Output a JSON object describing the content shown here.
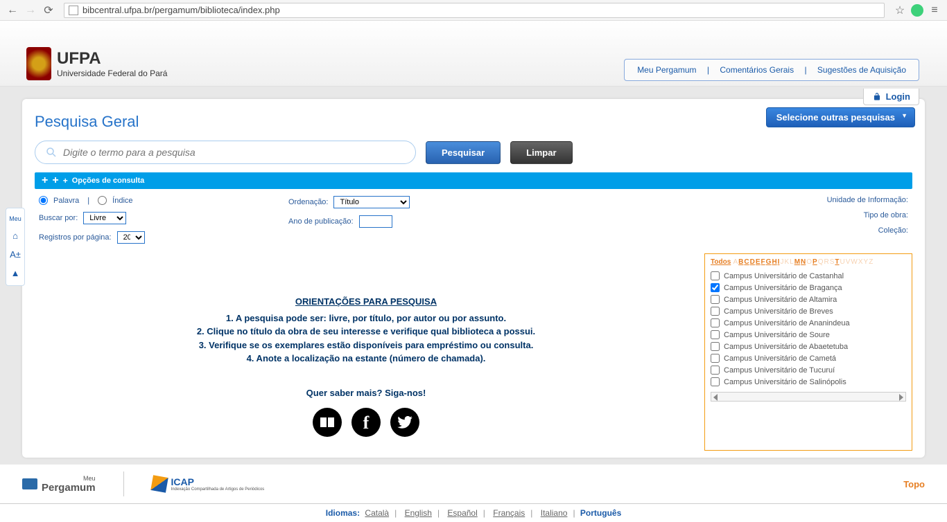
{
  "browser": {
    "url": "bibcentral.ufpa.br/pergamum/biblioteca/index.php"
  },
  "header": {
    "org_short": "UFPA",
    "org_full": "Universidade Federal do Pará",
    "links": {
      "my_pergamum": "Meu Pergamum",
      "comments": "Comentários Gerais",
      "suggestions": "Sugestões de Aquisição"
    },
    "login": "Login"
  },
  "search": {
    "title": "Pesquisa Geral",
    "other_searches": "Selecione outras pesquisas",
    "placeholder": "Digite o termo para a pesquisa",
    "btn_search": "Pesquisar",
    "btn_clear": "Limpar"
  },
  "options": {
    "title": "Opções de consulta",
    "mode_word": "Palavra",
    "mode_index": "Índice",
    "search_by_label": "Buscar por:",
    "search_by_value": "Livre",
    "records_label": "Registros por página:",
    "records_value": "20",
    "sort_label": "Ordenação:",
    "sort_value": "Título",
    "year_label": "Ano de publicação:",
    "unit_label": "Unidade de Informação:",
    "type_label": "Tipo de obra:",
    "collection_label": "Coleção:"
  },
  "instructions": {
    "title": "ORIENTAÇÕES PARA PESQUISA",
    "line1": "1. A pesquisa pode ser: livre, por título, por autor ou por assunto.",
    "line2": "2. Clique no título da obra de seu interesse e verifique qual biblioteca a possui.",
    "line3": "3. Verifique se os exemplares estão disponíveis para empréstimo ou consulta.",
    "line4": "4. Anote a localização na estante (número de chamada).",
    "follow": "Quer saber mais? Siga-nos!"
  },
  "alpha": {
    "todos": "Todos",
    "letters": [
      "A",
      "B",
      "C",
      "D",
      "E",
      "F",
      "G",
      "H",
      "I",
      "J",
      "K",
      "L",
      "M",
      "N",
      "O",
      "P",
      "Q",
      "R",
      "S",
      "T",
      "U",
      "V",
      "W",
      "X",
      "Y",
      "Z"
    ],
    "active": [
      "B",
      "C",
      "D",
      "E",
      "F",
      "G",
      "H",
      "I",
      "M",
      "N",
      "P",
      "T"
    ]
  },
  "campus": [
    {
      "label": "Campus Universitário de Castanhal",
      "checked": false
    },
    {
      "label": "Campus Universitário de Bragança",
      "checked": true
    },
    {
      "label": "Campus Universitário de Altamira",
      "checked": false
    },
    {
      "label": "Campus Universitário de Breves",
      "checked": false
    },
    {
      "label": "Campus Universitário de Ananindeua",
      "checked": false
    },
    {
      "label": "Campus Universitário de Soure",
      "checked": false
    },
    {
      "label": "Campus Universitário de Abaetetuba",
      "checked": false
    },
    {
      "label": "Campus Universitário de Cametá",
      "checked": false
    },
    {
      "label": "Campus Universitário de Tucuruí",
      "checked": false
    },
    {
      "label": "Campus Universitário de Salinópolis",
      "checked": false
    }
  ],
  "footer": {
    "pergamum_sup": "Meu",
    "pergamum_name": "Pergamum",
    "icap_name": "ICAP",
    "icap_sub": "Indexação Compartilhada de Artigos de Periódicos",
    "topo": "Topo"
  },
  "lang": {
    "label": "Idiomas:",
    "items": [
      "Català",
      "English",
      "Español",
      "Français",
      "Italiano"
    ],
    "active": "Português"
  },
  "side": {
    "my": "Meu",
    "font": "A±"
  }
}
